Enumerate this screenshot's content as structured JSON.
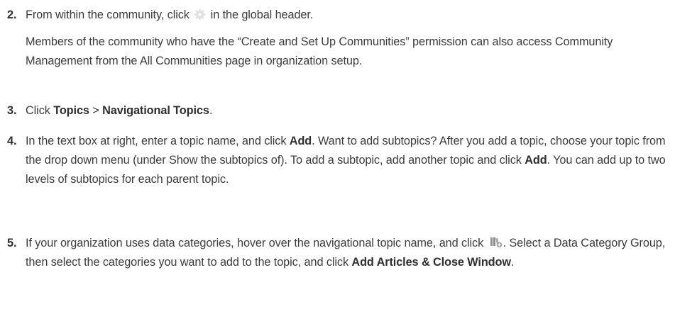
{
  "steps": [
    {
      "number": "2.",
      "text_before_icon": "From within the community, click ",
      "icon": "gear-icon",
      "text_after_icon": " in the global header.",
      "note": "Members of the community who have the “Create and Set Up Communities” permission can also access Community Management from the All Communities page in organization setup."
    },
    {
      "number": "3.",
      "t1": "Click ",
      "b1": "Topics",
      "t2": " > ",
      "b2": "Navigational Topics",
      "t3": "."
    },
    {
      "number": "4.",
      "t1": "In the text box at right, enter a topic name, and click ",
      "b1": "Add",
      "t2": ". Want to add subtopics? After you add a topic, choose your topic from the drop down menu (under Show the subtopics of). To add a subtopic, add another topic and click ",
      "b2": "Add",
      "t3": ". You can add up to two levels of subtopics for each parent topic."
    },
    {
      "number": "5.",
      "t1": "If your organization uses data categories, hover over the navigational topic name, and click ",
      "icon": "data-category-icon",
      "t2": ". Select a Data Category Group, then select the categories you want to add to the topic, and click ",
      "b1": "Add Articles & Close Window",
      "t3": "."
    }
  ],
  "colors": {
    "text": "#3c3c3c",
    "gear_icon": "#d8dde2",
    "category_icon": "#8a9096"
  }
}
